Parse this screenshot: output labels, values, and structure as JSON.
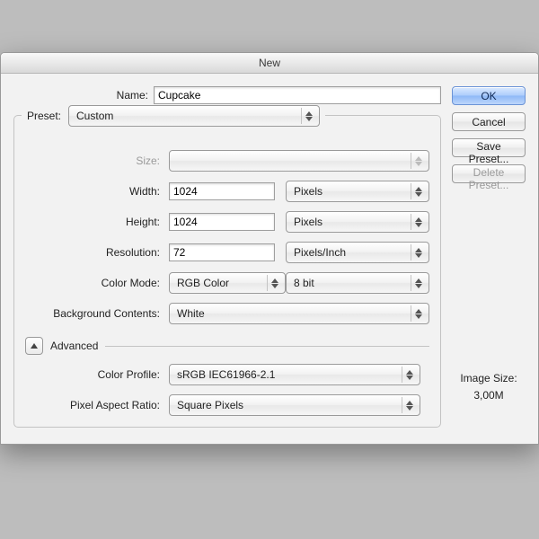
{
  "title": "New",
  "name": {
    "label": "Name:",
    "value": "Cupcake"
  },
  "preset": {
    "label": "Preset:",
    "value": "Custom"
  },
  "size": {
    "label": "Size:",
    "value": ""
  },
  "width": {
    "label": "Width:",
    "value": "1024",
    "unit": "Pixels"
  },
  "height": {
    "label": "Height:",
    "value": "1024",
    "unit": "Pixels"
  },
  "resolution": {
    "label": "Resolution:",
    "value": "72",
    "unit": "Pixels/Inch"
  },
  "colorMode": {
    "label": "Color Mode:",
    "value": "RGB Color",
    "depth": "8 bit"
  },
  "bgContents": {
    "label": "Background Contents:",
    "value": "White"
  },
  "advanced": {
    "label": "Advanced"
  },
  "colorProfile": {
    "label": "Color Profile:",
    "value": "sRGB IEC61966-2.1"
  },
  "pixelAspect": {
    "label": "Pixel Aspect Ratio:",
    "value": "Square Pixels"
  },
  "buttons": {
    "ok": "OK",
    "cancel": "Cancel",
    "savePreset": "Save Preset...",
    "deletePreset": "Delete Preset..."
  },
  "imageSize": {
    "label": "Image Size:",
    "value": "3,00M"
  }
}
